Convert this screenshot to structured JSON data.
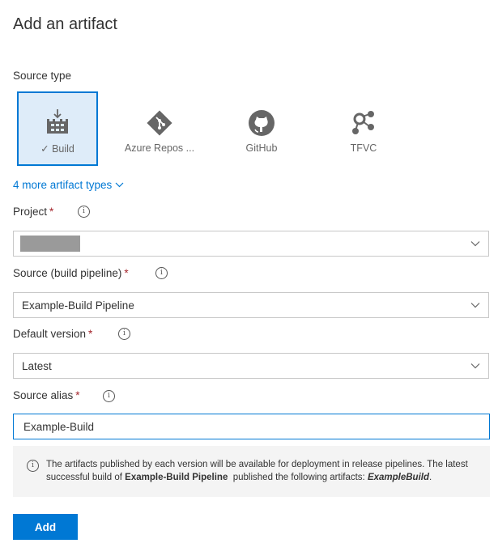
{
  "title": "Add an artifact",
  "source_type": {
    "label": "Source type",
    "tiles": [
      {
        "label": "Build",
        "icon": "build-icon",
        "selected": true,
        "check": "✓"
      },
      {
        "label": "Azure Repos ...",
        "icon": "git-icon",
        "selected": false
      },
      {
        "label": "GitHub",
        "icon": "github-icon",
        "selected": false
      },
      {
        "label": "TFVC",
        "icon": "tfvc-icon",
        "selected": false
      }
    ],
    "more_link": "4 more artifact types"
  },
  "fields": {
    "project": {
      "label": "Project",
      "required": "*",
      "value": ""
    },
    "source": {
      "label": "Source (build pipeline)",
      "required": "*",
      "value": "Example-Build Pipeline"
    },
    "default_version": {
      "label": "Default version",
      "required": "*",
      "value": "Latest"
    },
    "source_alias": {
      "label": "Source alias",
      "required": "*",
      "value": "Example-Build"
    }
  },
  "info_glyph": "i",
  "note": {
    "text_1": "The artifacts published by each version will be available for deployment in release pipelines. The latest successful build of ",
    "pipeline": "Example-Build Pipeline",
    "text_2": "  published the following artifacts: ",
    "artifact": "ExampleBuild",
    "text_3": "."
  },
  "add_button": "Add",
  "colors": {
    "accent": "#0078d4",
    "required": "#a4262c",
    "selected_bg": "#deecf9"
  }
}
